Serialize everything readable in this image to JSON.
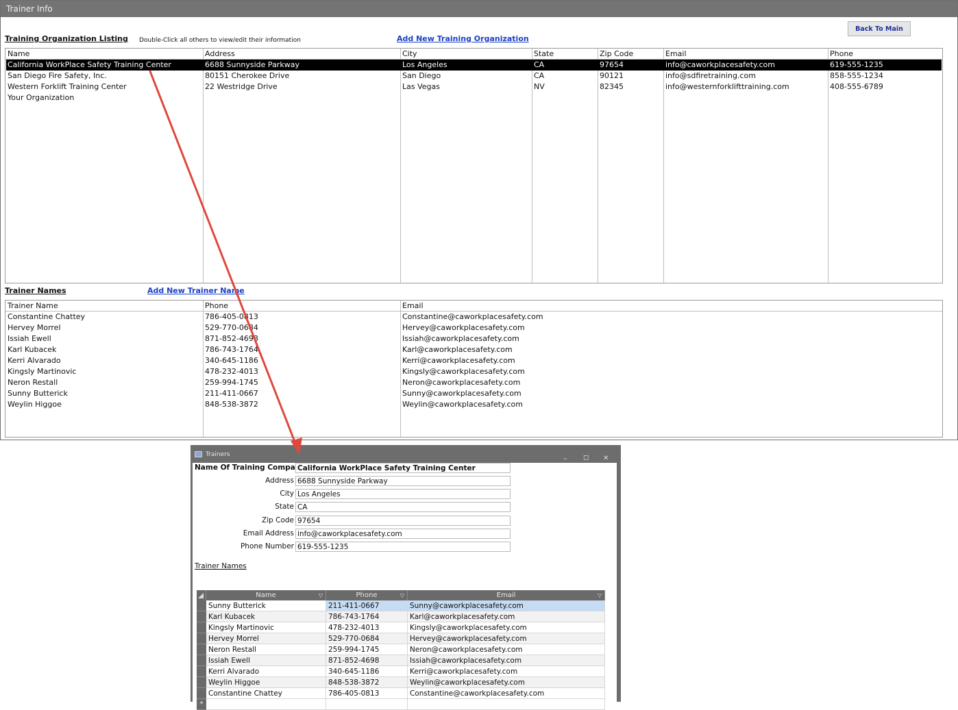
{
  "main_window": {
    "title": "Trainer Info"
  },
  "org_section": {
    "label": "Training Organization Listing",
    "hint": "Double-Click all others to view/edit their information",
    "add_link": "Add New Training Organization"
  },
  "back_button": "Back To Main",
  "org_list": {
    "headers": [
      "Name",
      "Address",
      "City",
      "State",
      "Zip Code",
      "Email",
      "Phone"
    ],
    "rows": [
      [
        "California WorkPlace Safety Training Center",
        "6688 Sunnyside Parkway",
        "Los Angeles",
        "CA",
        "97654",
        "info@caworkplacesafety.com",
        "619-555-1235"
      ],
      [
        "San Diego Fire Safety, Inc.",
        "80151 Cherokee Drive",
        "San Diego",
        "CA",
        "90121",
        "info@sdfiretraining.com",
        "858-555-1234"
      ],
      [
        "Western Forklift Training Center",
        "22 Westridge Drive",
        "Las Vegas",
        "NV",
        "82345",
        "info@westernforklifttraining.com",
        "408-555-6789"
      ],
      [
        "Your Organization",
        "",
        "",
        "",
        "",
        "",
        ""
      ]
    ]
  },
  "trainer_section": {
    "label": "Trainer Names",
    "add_link": "Add New Trainer Name"
  },
  "trainer_list": {
    "headers": [
      "Trainer Name",
      "Phone",
      "Email"
    ],
    "rows": [
      [
        "Constantine Chattey",
        "786-405-0813",
        "Constantine@caworkplacesafety.com"
      ],
      [
        "Hervey Morrel",
        "529-770-0684",
        "Hervey@caworkplacesafety.com"
      ],
      [
        "Issiah Ewell",
        "871-852-4698",
        "Issiah@caworkplacesafety.com"
      ],
      [
        "Karl Kubacek",
        "786-743-1764",
        "Karl@caworkplacesafety.com"
      ],
      [
        "Kerri Alvarado",
        "340-645-1186",
        "Kerri@caworkplacesafety.com"
      ],
      [
        "Kingsly Martinovic",
        "478-232-4013",
        "Kingsly@caworkplacesafety.com"
      ],
      [
        "Neron Restall",
        "259-994-1745",
        "Neron@caworkplacesafety.com"
      ],
      [
        "Sunny Butterick",
        "211-411-0667",
        "Sunny@caworkplacesafety.com"
      ],
      [
        "Weylin Higgoe",
        "848-538-3872",
        "Weylin@caworkplacesafety.com"
      ]
    ]
  },
  "dialog": {
    "title": "Trainers",
    "controls": {
      "minimize": "–",
      "maximize": "◻",
      "close": "✕"
    },
    "fields": {
      "company_label": "Name Of Training Company",
      "company_value": "California WorkPlace Safety Training Center",
      "address_label": "Address",
      "address_value": "6688 Sunnyside Parkway",
      "city_label": "City",
      "city_value": "Los Angeles",
      "state_label": "State",
      "state_value": "CA",
      "zip_label": "Zip Code",
      "zip_value": "97654",
      "email_label": "Email Address",
      "email_value": "info@caworkplacesafety.com",
      "phone_label": "Phone Number",
      "phone_value": "619-555-1235"
    },
    "subform_label": "Trainer Names",
    "grid_headers": [
      "Name",
      "Phone",
      "Email"
    ],
    "grid_rows": [
      [
        "Sunny Butterick",
        "211-411-0667",
        "Sunny@caworkplacesafety.com"
      ],
      [
        "Karl Kubacek",
        "786-743-1764",
        "Karl@caworkplacesafety.com"
      ],
      [
        "Kingsly Martinovic",
        "478-232-4013",
        "Kingsly@caworkplacesafety.com"
      ],
      [
        "Hervey Morrel",
        "529-770-0684",
        "Hervey@caworkplacesafety.com"
      ],
      [
        "Neron Restall",
        "259-994-1745",
        "Neron@caworkplacesafety.com"
      ],
      [
        "Issiah Ewell",
        "871-852-4698",
        "Issiah@caworkplacesafety.com"
      ],
      [
        "Kerri Alvarado",
        "340-645-1186",
        "Kerri@caworkplacesafety.com"
      ],
      [
        "Weylin Higgoe",
        "848-538-3872",
        "Weylin@caworkplacesafety.com"
      ],
      [
        "Constantine Chattey",
        "786-405-0813",
        "Constantine@caworkplacesafety.com"
      ]
    ],
    "new_row_marker": "*"
  },
  "colors": {
    "link": "#1a3fc4",
    "selection": "#000000",
    "grid_selection": "#c5dcf3",
    "arrow": "#e0473c"
  }
}
